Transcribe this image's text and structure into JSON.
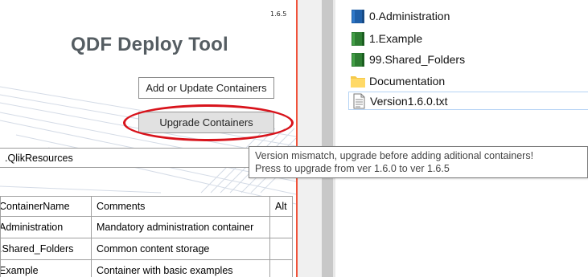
{
  "tool": {
    "version": "1.6.5",
    "title": "QDF Deploy Tool",
    "add_button_label": "Add or Update Containers",
    "upgrade_button_label": "Upgrade Containers",
    "resource_path": ".QlikResources",
    "grid": {
      "headers": [
        "ContainerName",
        "Comments",
        "Alt"
      ],
      "rows": [
        [
          "Administration",
          "Mandatory administration container",
          ""
        ],
        [
          ".Shared_Folders",
          "Common content storage",
          ""
        ],
        [
          "Example",
          "Container with basic examples",
          ""
        ]
      ]
    }
  },
  "tooltip": {
    "line1": "Version mismatch, upgrade before adding aditional containers!",
    "line2": "Press to upgrade from ver 1.6.0 to ver 1.6.5"
  },
  "explorer": {
    "items": [
      {
        "name": "0.Administration",
        "icon": "folder-blue-icon"
      },
      {
        "name": "1.Example",
        "icon": "folder-green-icon"
      },
      {
        "name": "99.Shared_Folders",
        "icon": "folder-green-icon"
      },
      {
        "name": "Documentation",
        "icon": "folder-yellow-icon"
      },
      {
        "name": "Version1.6.0.txt",
        "icon": "text-file-icon"
      }
    ]
  },
  "colors": {
    "annotation_red": "#d8131b",
    "title_gray": "#555d62",
    "divider_red": "#f0533b",
    "folder_blue": "#1f5fa8",
    "folder_green": "#2e7d32",
    "folder_yellow": "#f5c94a"
  }
}
